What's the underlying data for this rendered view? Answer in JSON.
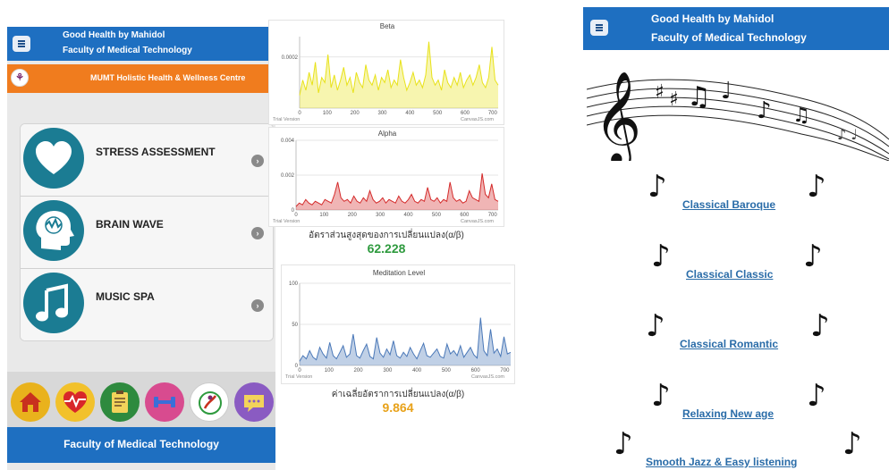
{
  "left_phone": {
    "header": {
      "line1": "Good Health by Mahidol",
      "line2": "Faculty of Medical Technology"
    },
    "orange_bar": {
      "logo_glyph": "⚘",
      "text": "MUMT Holistic Health & Wellness Centre"
    },
    "menu": [
      {
        "label": "STRESS ASSESSMENT",
        "icon": "heart-icon"
      },
      {
        "label": "BRAIN WAVE",
        "icon": "brain-head-icon"
      },
      {
        "label": "MUSIC SPA",
        "icon": "music-note-icon"
      }
    ],
    "dock": [
      {
        "icon": "home-icon",
        "color": "#e9b21c"
      },
      {
        "icon": "heartbeat-icon",
        "color": "#f2c12b"
      },
      {
        "icon": "clipboard-icon",
        "color": "#2e8a3e"
      },
      {
        "icon": "dumbbell-icon",
        "color": "#d84b8f"
      },
      {
        "icon": "logo-icon",
        "color": "#ffffff"
      },
      {
        "icon": "chat-icon",
        "color": "#8a5bc2"
      }
    ],
    "footer": "Faculty of Medical Technology"
  },
  "charts": {
    "beta": {
      "title": "Beta",
      "credit_left": "Trial Version",
      "credit_right": "CanvasJS.com"
    },
    "alpha": {
      "title": "Alpha",
      "credit_left": "Trial Version",
      "credit_right": "CanvasJS.com"
    },
    "ratio_label": "อัตราส่วนสูงสุดของการเปลี่ยนแปลง(α/β)",
    "ratio_value": "62.228",
    "meditation": {
      "title": "Meditation Level",
      "credit_left": "Trial Version",
      "credit_right": "CanvasJS.com"
    },
    "avg_label": "ค่าเฉลี่ยอัตราการเปลี่ยนแปลง(α/β)",
    "avg_value": "9.864",
    "colors": {
      "beta": "#e8e21a",
      "alpha": "#d42a2a",
      "meditation": "#4a78b8",
      "ratio_value": "#2e9a3e",
      "avg_value": "#e8a21a"
    }
  },
  "chart_data": [
    {
      "type": "area",
      "title": "Beta",
      "x_ticks": [
        0,
        100,
        200,
        300,
        400,
        500,
        600,
        700
      ],
      "y_ticks": [
        "0.0002"
      ],
      "xlim": [
        0,
        720
      ],
      "series": [
        {
          "name": "",
          "values": [
            5e-05,
            0.00011,
            7e-05,
            0.00014,
            9e-05,
            0.00018,
            6e-05,
            0.00012,
            0.0001,
            0.00021,
            8e-05,
            0.00013,
            7e-05,
            0.00011,
            0.00016,
            9e-05,
            0.00012,
            6e-05,
            0.00014,
            0.0001,
            8e-05,
            0.00017,
            0.00011,
            9e-05,
            0.00013,
            7e-05,
            0.00012,
            0.0001,
            0.00015,
            8e-05,
            0.00011,
            9e-05,
            0.00019,
            0.00012,
            7e-05,
            0.0001,
            0.00014,
            9e-05,
            0.00011,
            8e-05,
            0.00013,
            0.00026,
            0.00012,
            9e-05,
            0.00011,
            7e-05,
            0.00015,
            0.0001,
            8e-05,
            0.00012,
            9e-05,
            0.00014,
            8e-05,
            0.00011,
            0.00013,
            9e-05,
            0.00012,
            0.00017,
            0.0001,
            8e-05,
            0.00012,
            0.00024,
            0.00011,
            9e-05
          ]
        }
      ]
    },
    {
      "type": "area",
      "title": "Alpha",
      "x_ticks": [
        0,
        100,
        200,
        300,
        400,
        500,
        600,
        700
      ],
      "y_ticks": [
        "0",
        "0.002",
        "0.004"
      ],
      "ylim": [
        0,
        0.004
      ],
      "xlim": [
        0,
        720
      ],
      "series": [
        {
          "name": "",
          "values": [
            0.0002,
            0.0004,
            0.0003,
            0.0006,
            0.0004,
            0.0003,
            0.0005,
            0.0004,
            0.0003,
            0.0006,
            0.0005,
            0.0004,
            0.0009,
            0.0016,
            0.0007,
            0.0005,
            0.0006,
            0.0004,
            0.0008,
            0.0005,
            0.0004,
            0.0007,
            0.0005,
            0.0011,
            0.0006,
            0.0004,
            0.0005,
            0.0007,
            0.0004,
            0.0006,
            0.0005,
            0.0004,
            0.0008,
            0.0005,
            0.0004,
            0.0006,
            0.0009,
            0.0005,
            0.0004,
            0.0006,
            0.0005,
            0.0013,
            0.0006,
            0.0005,
            0.0007,
            0.0004,
            0.0006,
            0.0005,
            0.0016,
            0.0007,
            0.0005,
            0.0006,
            0.0004,
            0.0005,
            0.0011,
            0.0007,
            0.0006,
            0.0005,
            0.0021,
            0.0009,
            0.0007,
            0.0015,
            0.0006,
            0.0005
          ]
        }
      ]
    },
    {
      "type": "area",
      "title": "Meditation Level",
      "x_ticks": [
        0,
        100,
        200,
        300,
        400,
        500,
        600,
        700
      ],
      "y_ticks": [
        "0",
        "50",
        "100"
      ],
      "ylim": [
        0,
        100
      ],
      "xlim": [
        0,
        720
      ],
      "series": [
        {
          "name": "",
          "values": [
            5,
            12,
            8,
            18,
            10,
            7,
            22,
            14,
            9,
            28,
            12,
            8,
            16,
            24,
            10,
            14,
            38,
            12,
            9,
            18,
            26,
            11,
            8,
            34,
            15,
            10,
            20,
            13,
            30,
            12,
            9,
            16,
            11,
            22,
            14,
            8,
            18,
            27,
            12,
            10,
            15,
            20,
            11,
            9,
            26,
            14,
            18,
            12,
            24,
            10,
            16,
            22,
            13,
            9,
            58,
            18,
            12,
            44,
            15,
            20,
            11,
            35,
            14,
            16
          ]
        }
      ]
    }
  ],
  "right_phone": {
    "header": {
      "line1": "Good Health by Mahidol",
      "line2": "Faculty of Medical Technology"
    },
    "links": [
      "Classical Baroque",
      "Classical Classic",
      "Classical Romantic",
      "Relaxing New age",
      "Smooth Jazz & Easy listening"
    ],
    "note_glyph": "♪"
  }
}
